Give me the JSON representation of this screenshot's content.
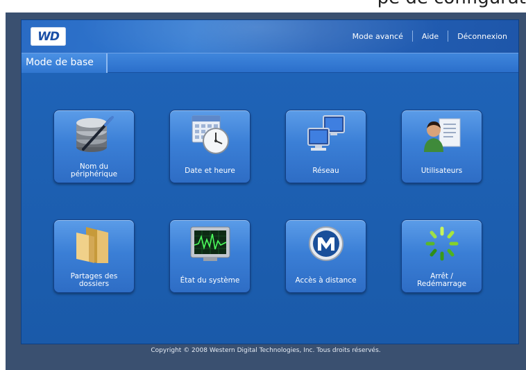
{
  "top_caption": "pe de configurat",
  "header": {
    "logo_text": "WD",
    "nav": [
      "Mode avancé",
      "Aide",
      "Déconnexion"
    ]
  },
  "titlebar": {
    "title": "Mode de base"
  },
  "tiles": [
    {
      "label": "Nom du\npériphérique",
      "icon": "database-pen-icon"
    },
    {
      "label": "Date et heure",
      "icon": "calendar-clock-icon"
    },
    {
      "label": "Réseau",
      "icon": "network-computers-icon"
    },
    {
      "label": "Utilisateurs",
      "icon": "user-document-icon"
    },
    {
      "label": "Partages des\ndossiers",
      "icon": "folder-icon"
    },
    {
      "label": "État du système",
      "icon": "system-monitor-icon"
    },
    {
      "label": "Accès à distance",
      "icon": "mionet-icon"
    },
    {
      "label": "Arrêt /\nRedémarrage",
      "icon": "restart-spinner-icon"
    }
  ],
  "footer": {
    "copyright": "Copyright © 2008 Western Digital Technologies, Inc. Tous droits réservés."
  },
  "colors": {
    "frame_blue": "#1d5fb0",
    "tile_blue": "#3b7fd6",
    "outer_bg": "#3a5070"
  }
}
